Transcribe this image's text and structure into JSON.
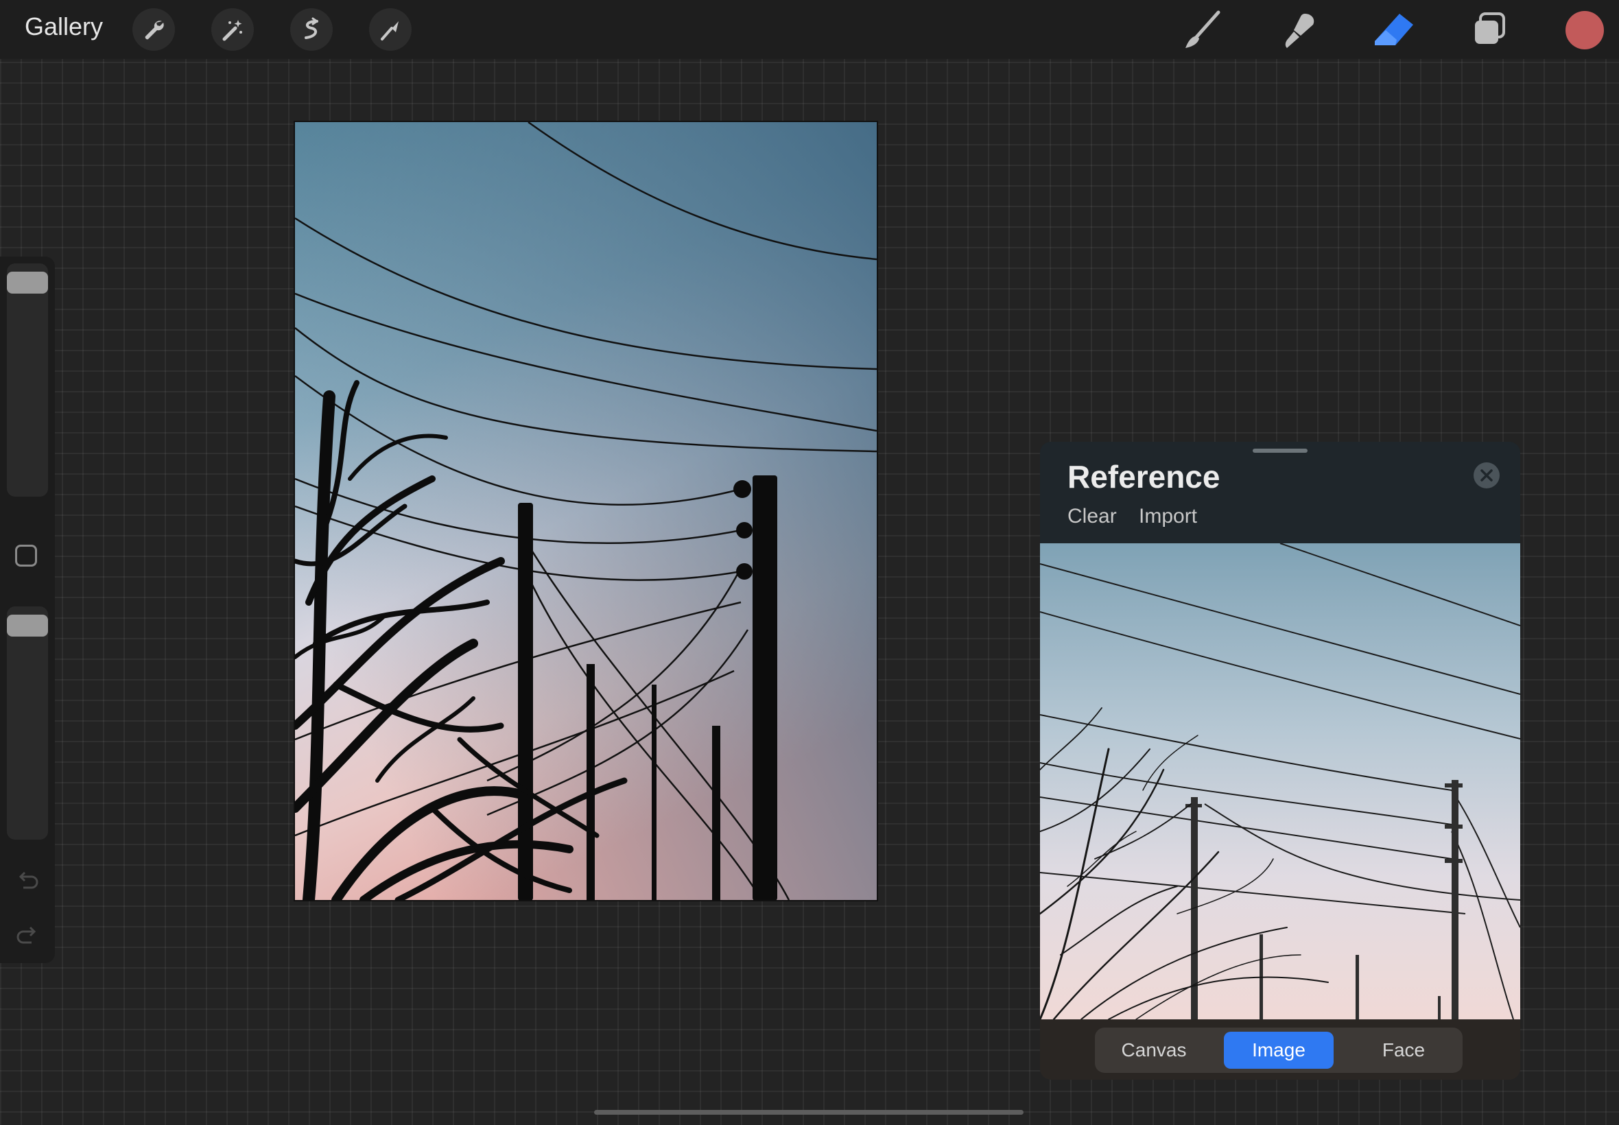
{
  "topbar": {
    "gallery_label": "Gallery",
    "left_tools": [
      "wrench-icon",
      "magic-wand-icon",
      "selection-icon",
      "transform-arrow-icon"
    ],
    "right_tools": [
      "brush-icon",
      "smudge-icon",
      "eraser-icon",
      "layers-icon"
    ],
    "color_swatch": "#c25a5a",
    "active_tool": "eraser",
    "accent": "#2f79f2"
  },
  "sidebar": {
    "brush_size_slider": "slider",
    "modifier_button": "square-modifier",
    "opacity_slider": "slider",
    "undo_icon": "undo-icon",
    "redo_icon": "redo-icon"
  },
  "reference": {
    "title": "Reference",
    "tabs": [
      "Clear",
      "Import"
    ],
    "close_icon": "close-icon",
    "segments": [
      "Canvas",
      "Image",
      "Face"
    ],
    "active_segment": "Image"
  }
}
